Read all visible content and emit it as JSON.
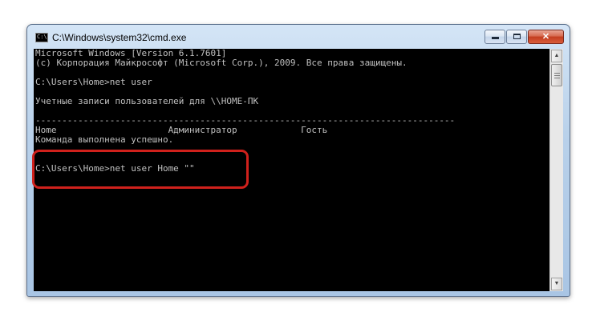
{
  "window": {
    "title": "C:\\Windows\\system32\\cmd.exe",
    "icon_text": "C:\\",
    "controls": {
      "minimize": "minimize-icon",
      "maximize": "maximize-icon",
      "close": "✕"
    }
  },
  "console": {
    "lines": [
      "Microsoft Windows [Version 6.1.7601]",
      "(c) Корпорация Майкрософт (Microsoft Corp.), 2009. Все права защищены.",
      "",
      "C:\\Users\\Home>net user",
      "",
      "Учетные записи пользователей для \\\\HOME-ПК",
      "",
      "-------------------------------------------------------------------------------",
      "Home                     Администратор            Гость",
      "Команда выполнена успешно.",
      "",
      "",
      "C:\\Users\\Home>net user Home \"\""
    ]
  },
  "scrollbar": {
    "up": "▲",
    "down": "▼"
  },
  "colors": {
    "highlight": "#d0211c",
    "console_bg": "#000000",
    "console_fg": "#c0c0c0"
  }
}
